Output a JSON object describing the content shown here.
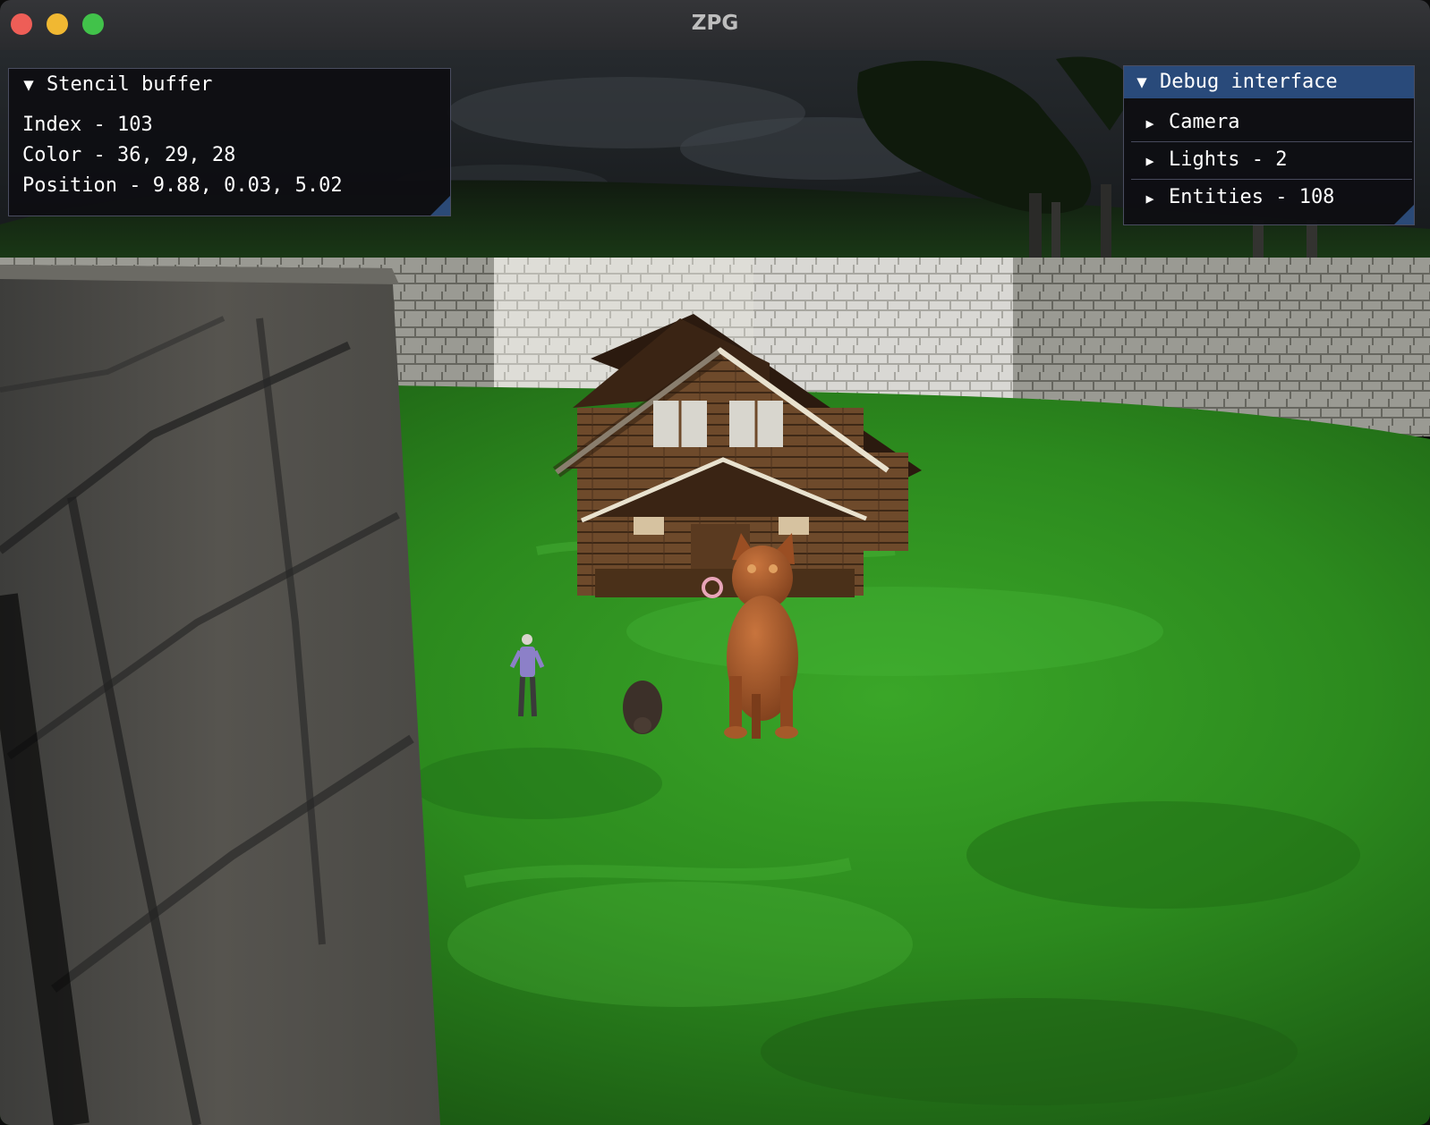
{
  "window": {
    "title": "ZPG"
  },
  "stencil_panel": {
    "title": "Stencil buffer",
    "index_line": "Index - 103",
    "color_line": "Color - 36, 29, 28",
    "position_line": "Position - 9.88, 0.03, 5.02"
  },
  "debug_panel": {
    "title": "Debug interface",
    "nodes": [
      {
        "label": "Camera"
      },
      {
        "label": "Lights - 2"
      },
      {
        "label": "Entities - 108"
      }
    ]
  },
  "colors": {
    "titlebar": "#2f3033",
    "panel_header_active": "#294a7a",
    "grass": "#2f8e20",
    "stone_wall": "#a4a49c",
    "cursor_ring": "#e8a4b8"
  }
}
